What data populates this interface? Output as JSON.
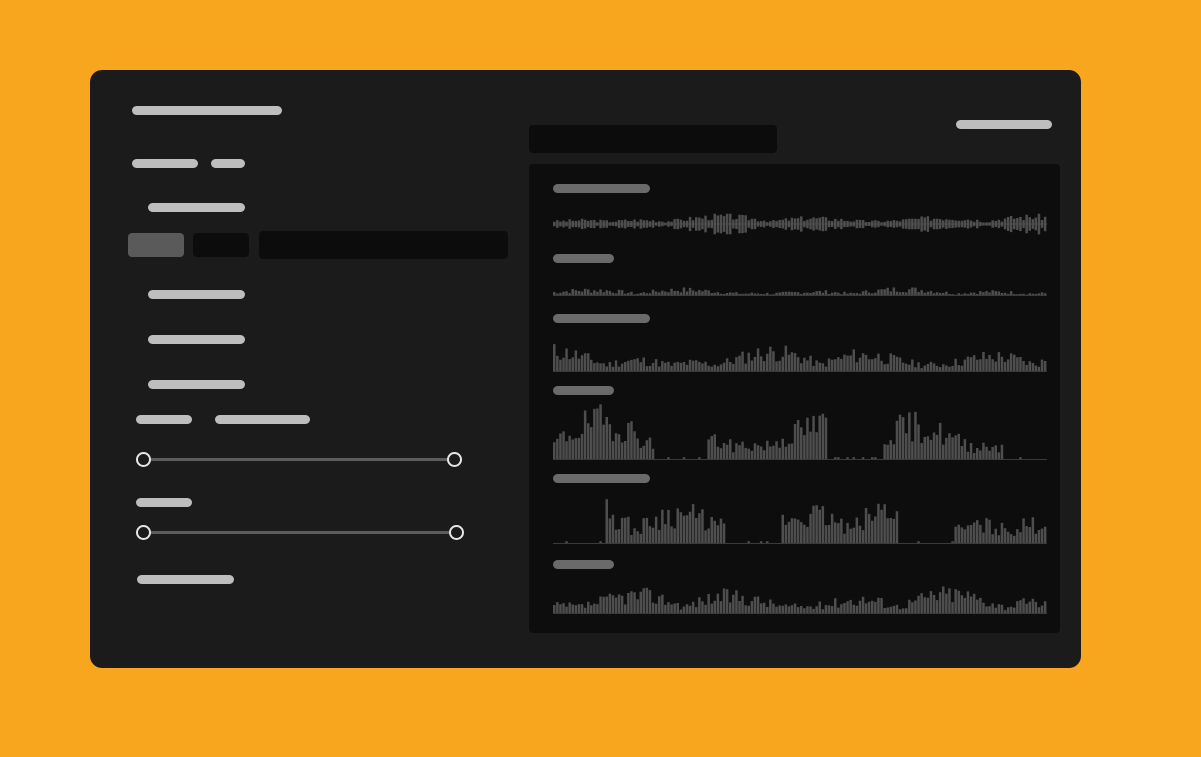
{
  "header": {
    "title": "",
    "action_label": ""
  },
  "search": {
    "placeholder": ""
  },
  "left": {
    "tabs": [
      "",
      ""
    ],
    "section_label": "",
    "segments": [
      "",
      ""
    ],
    "input_value": "",
    "options": [
      "",
      "",
      ""
    ],
    "range_labels": [
      "",
      ""
    ],
    "range1": {
      "low": 0.0,
      "high": 1.0
    },
    "range2_label": "",
    "range2": {
      "low": 0.0,
      "high": 1.0
    },
    "footer_link": ""
  },
  "tracks": [
    {
      "label": "",
      "shape": "centered",
      "seed": 3,
      "amp": 0.55
    },
    {
      "label": "",
      "shape": "bottom-low",
      "seed": 7,
      "amp": 0.35
    },
    {
      "label": "",
      "shape": "bottom",
      "seed": 11,
      "amp": 0.75
    },
    {
      "label": "",
      "shape": "bottom-gapped",
      "seed": 19,
      "amp": 1.0
    },
    {
      "label": "",
      "shape": "bottom-gapped",
      "seed": 29,
      "amp": 1.0
    },
    {
      "label": "",
      "shape": "bottom",
      "seed": 37,
      "amp": 0.75
    }
  ],
  "colors": {
    "background": "#F7A61D",
    "window": "#1B1B1B",
    "panel": "#0D0D0D",
    "waveform": "#4E4E4E",
    "text_light": "#BEBEBE"
  }
}
